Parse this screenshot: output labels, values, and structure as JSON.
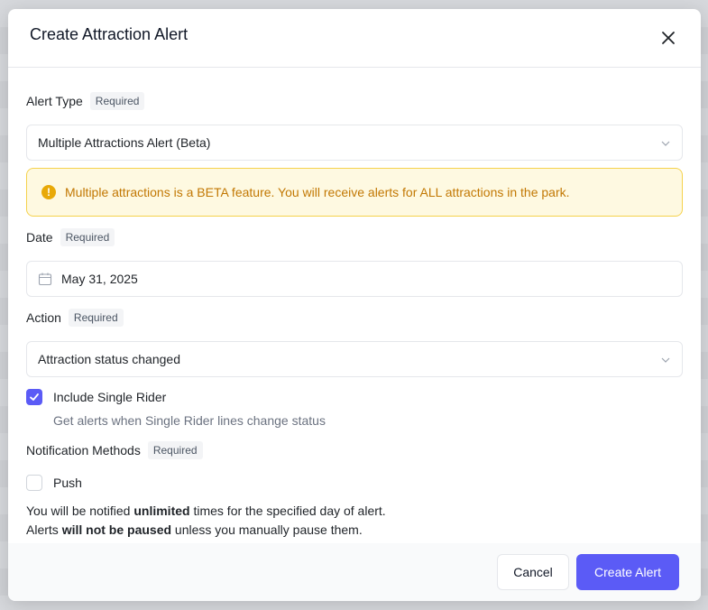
{
  "modal": {
    "title": "Create Attraction Alert"
  },
  "required_label": "Required",
  "alert_type": {
    "label": "Alert Type",
    "value": "Multiple Attractions Alert (Beta)"
  },
  "warning": {
    "text": "Multiple attractions is a BETA feature. You will receive alerts for ALL attractions in the park.",
    "color": "#c27803"
  },
  "date": {
    "label": "Date",
    "value": "May 31, 2025"
  },
  "action": {
    "label": "Action",
    "value": "Attraction status changed"
  },
  "single_rider": {
    "label": "Include Single Rider",
    "hint": "Get alerts when Single Rider lines change status",
    "checked": true
  },
  "notification": {
    "label": "Notification Methods",
    "push_label": "Push",
    "push_checked": false
  },
  "note": {
    "line1_pre": "You will be notified ",
    "line1_bold": "unlimited",
    "line1_post": " times for the specified day of alert.",
    "line2_pre": "Alerts ",
    "line2_bold": "will not be paused",
    "line2_post": " unless you manually pause them."
  },
  "footer": {
    "cancel_label": "Cancel",
    "create_label": "Create Alert"
  },
  "colors": {
    "accent": "#5b5bf6",
    "warning_bg": "#fef9e1",
    "warning_border": "#f5d24c"
  }
}
